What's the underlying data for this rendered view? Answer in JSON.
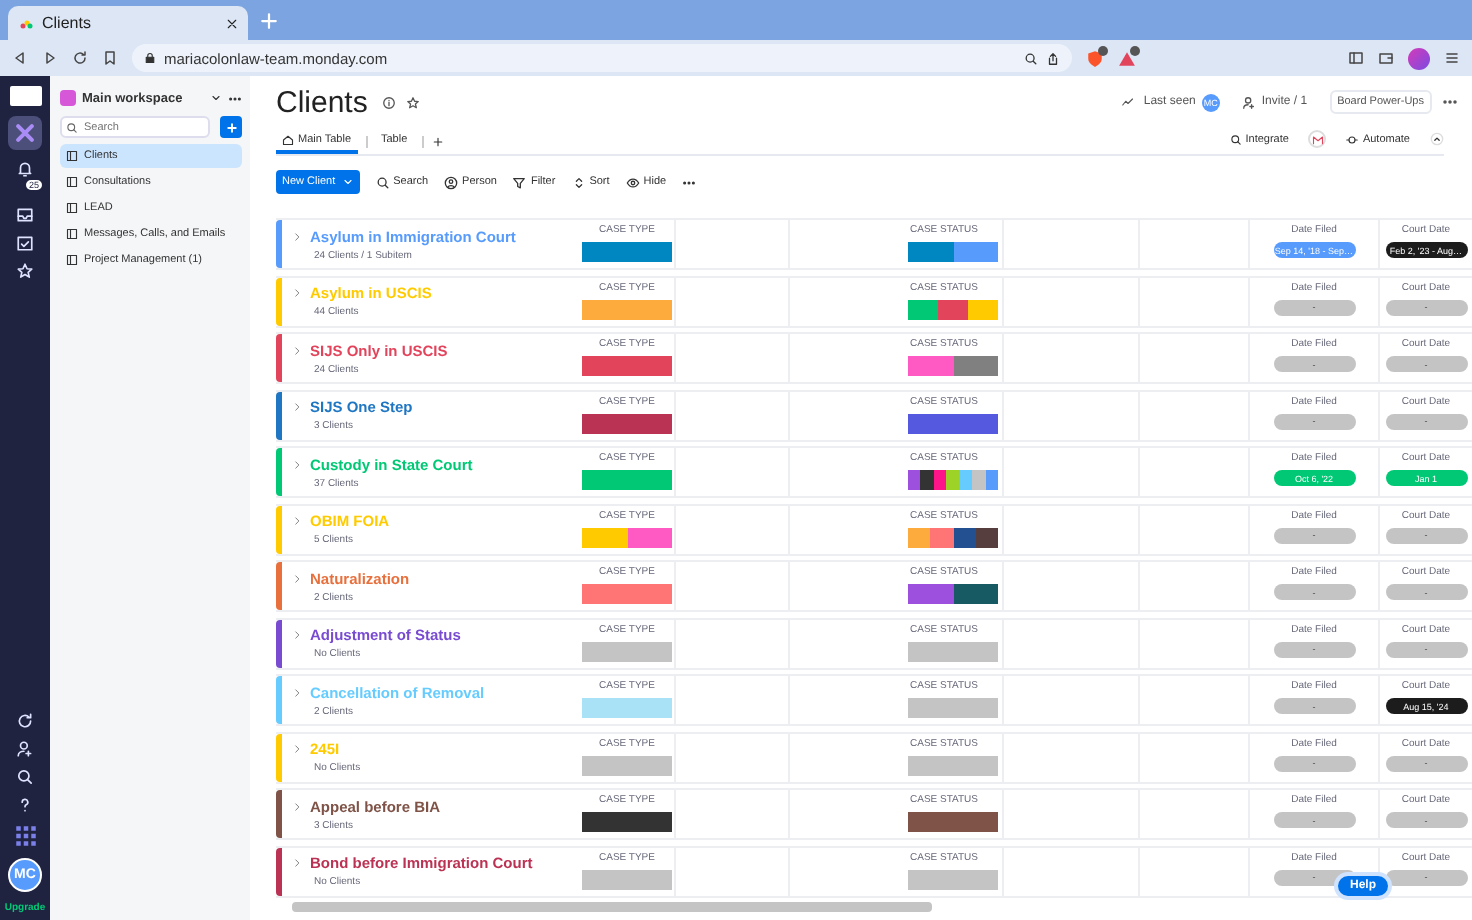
{
  "browser": {
    "tab_title": "Clients",
    "url": "mariacolonlaw-team.monday.com"
  },
  "rail": {
    "badge": "25",
    "avatar": "MC",
    "upgrade": "Upgrade"
  },
  "workspace": {
    "name": "Main workspace",
    "search_placeholder": "Search",
    "items": [
      {
        "label": "Clients",
        "selected": true
      },
      {
        "label": "Consultations",
        "selected": false
      },
      {
        "label": "LEAD",
        "selected": false
      },
      {
        "label": "Messages, Calls, and Emails",
        "selected": false
      },
      {
        "label": "Project Management (1)",
        "selected": false
      }
    ]
  },
  "board": {
    "title": "Clients",
    "last_seen": "Last seen",
    "last_seen_avatar": "MC",
    "invite": "Invite / 1",
    "power_ups": "Board Power-Ups",
    "integrate": "Integrate",
    "automate": "Automate",
    "views": [
      {
        "label": "Main Table",
        "selected": true
      },
      {
        "label": "Table",
        "selected": false
      }
    ],
    "new_button": "New Client",
    "actions": [
      {
        "label": "Search",
        "kind": "search"
      },
      {
        "label": "Person",
        "kind": "person"
      },
      {
        "label": "Filter",
        "kind": "filter"
      },
      {
        "label": "Sort",
        "kind": "sort"
      },
      {
        "label": "Hide",
        "kind": "hide"
      }
    ]
  },
  "groups": [
    {
      "name": "Asylum in Immigration Court",
      "count": "24 Clients / 1 Subitem",
      "color": "#579bfc",
      "case_type": {
        "label": "CASE TYPE",
        "segments": [
          {
            "color": "#0086c0"
          }
        ]
      },
      "case_status": {
        "label": "CASE STATUS",
        "segments": [
          {
            "color": "#0086c0"
          },
          {
            "color": "#579bfc"
          }
        ]
      },
      "date_filed": {
        "label": "Date Filed",
        "value": "Sep 14, '18 - Sep…",
        "color": "#579bfc"
      },
      "court_date": {
        "label": "Court Date",
        "value": "Feb 2, '23 - Aug…",
        "color": "#1c1c1c"
      }
    },
    {
      "name": "Asylum in USCIS",
      "count": "44 Clients",
      "color": "#ffcb00",
      "case_type": {
        "label": "CASE TYPE",
        "segments": [
          {
            "color": "#fdab3d"
          }
        ]
      },
      "case_status": {
        "label": "CASE STATUS",
        "segments": [
          {
            "color": "#00c875"
          },
          {
            "color": "#e2445c"
          },
          {
            "color": "#ffcb00"
          }
        ]
      },
      "date_filed": {
        "label": "Date Filed",
        "value": "-",
        "color": "#c4c4c4"
      },
      "court_date": {
        "label": "Court Date",
        "value": "-",
        "color": "#c4c4c4"
      }
    },
    {
      "name": "SIJS Only in USCIS",
      "count": "24 Clients",
      "color": "#e2445c",
      "case_type": {
        "label": "CASE TYPE",
        "segments": [
          {
            "color": "#e2445c"
          }
        ]
      },
      "case_status": {
        "label": "CASE STATUS",
        "segments": [
          {
            "color": "#ff5ac4"
          },
          {
            "color": "#808080"
          }
        ]
      },
      "date_filed": {
        "label": "Date Filed",
        "value": "-",
        "color": "#c4c4c4"
      },
      "court_date": {
        "label": "Court Date",
        "value": "-",
        "color": "#c4c4c4"
      }
    },
    {
      "name": "SIJS One Step",
      "count": "3 Clients",
      "color": "#1f76c2",
      "case_type": {
        "label": "CASE TYPE",
        "segments": [
          {
            "color": "#bb3354"
          }
        ]
      },
      "case_status": {
        "label": "CASE STATUS",
        "segments": [
          {
            "color": "#5559df"
          }
        ]
      },
      "date_filed": {
        "label": "Date Filed",
        "value": "-",
        "color": "#c4c4c4"
      },
      "court_date": {
        "label": "Court Date",
        "value": "-",
        "color": "#c4c4c4"
      }
    },
    {
      "name": "Custody in State Court",
      "count": "37 Clients",
      "color": "#00c875",
      "case_type": {
        "label": "CASE TYPE",
        "segments": [
          {
            "color": "#00c875"
          }
        ]
      },
      "case_status": {
        "label": "CASE STATUS",
        "segments": [
          {
            "color": "#9d50dd"
          },
          {
            "color": "#333333"
          },
          {
            "color": "#ff158a"
          },
          {
            "color": "#9cd326"
          },
          {
            "color": "#66ccff"
          },
          {
            "color": "#c4c4c4"
          },
          {
            "color": "#579bfc"
          }
        ]
      },
      "date_filed": {
        "label": "Date Filed",
        "value": "Oct 6, '22",
        "color": "#00c875"
      },
      "court_date": {
        "label": "Court Date",
        "value": "Jan 1",
        "color": "#00c875"
      }
    },
    {
      "name": "OBIM FOIA",
      "count": "5 Clients",
      "color": "#ffcb00",
      "case_type": {
        "label": "CASE TYPE",
        "segments": [
          {
            "color": "#ffcb00"
          },
          {
            "color": "#ff5ac4"
          }
        ]
      },
      "case_status": {
        "label": "CASE STATUS",
        "segments": [
          {
            "color": "#fdab3d"
          },
          {
            "color": "#ff7575"
          },
          {
            "color": "#225091"
          },
          {
            "color": "#563e3e"
          }
        ]
      },
      "date_filed": {
        "label": "Date Filed",
        "value": "-",
        "color": "#c4c4c4"
      },
      "court_date": {
        "label": "Court Date",
        "value": "-",
        "color": "#c4c4c4"
      }
    },
    {
      "name": "Naturalization",
      "count": "2 Clients",
      "color": "#e8703d",
      "case_type": {
        "label": "CASE TYPE",
        "segments": [
          {
            "color": "#ff7575"
          }
        ]
      },
      "case_status": {
        "label": "CASE STATUS",
        "segments": [
          {
            "color": "#9d50dd"
          },
          {
            "color": "#175a63"
          }
        ]
      },
      "date_filed": {
        "label": "Date Filed",
        "value": "-",
        "color": "#c4c4c4"
      },
      "court_date": {
        "label": "Court Date",
        "value": "-",
        "color": "#c4c4c4"
      }
    },
    {
      "name": "Adjustment of Status",
      "count": "No Clients",
      "color": "#784bd1",
      "case_type": {
        "label": "CASE TYPE",
        "segments": [
          {
            "color": "#c4c4c4"
          }
        ]
      },
      "case_status": {
        "label": "CASE STATUS",
        "segments": [
          {
            "color": "#c4c4c4"
          }
        ]
      },
      "date_filed": {
        "label": "Date Filed",
        "value": "-",
        "color": "#c4c4c4"
      },
      "court_date": {
        "label": "Court Date",
        "value": "-",
        "color": "#c4c4c4"
      }
    },
    {
      "name": "Cancellation of Removal",
      "count": "2 Clients",
      "color": "#66ccff",
      "case_type": {
        "label": "CASE TYPE",
        "segments": [
          {
            "color": "#a9e2f7"
          }
        ]
      },
      "case_status": {
        "label": "CASE STATUS",
        "segments": [
          {
            "color": "#c4c4c4"
          }
        ]
      },
      "date_filed": {
        "label": "Date Filed",
        "value": "-",
        "color": "#c4c4c4"
      },
      "court_date": {
        "label": "Court Date",
        "value": "Aug 15, '24",
        "color": "#1c1c1c"
      }
    },
    {
      "name": "245I",
      "count": "No Clients",
      "color": "#ffcb00",
      "case_type": {
        "label": "CASE TYPE",
        "segments": [
          {
            "color": "#c4c4c4"
          }
        ]
      },
      "case_status": {
        "label": "CASE STATUS",
        "segments": [
          {
            "color": "#c4c4c4"
          }
        ]
      },
      "date_filed": {
        "label": "Date Filed",
        "value": "-",
        "color": "#c4c4c4"
      },
      "court_date": {
        "label": "Court Date",
        "value": "-",
        "color": "#c4c4c4"
      }
    },
    {
      "name": "Appeal before BIA",
      "count": "3 Clients",
      "color": "#7f5347",
      "case_type": {
        "label": "CASE TYPE",
        "segments": [
          {
            "color": "#333333"
          }
        ]
      },
      "case_status": {
        "label": "CASE STATUS",
        "segments": [
          {
            "color": "#7f5347"
          }
        ]
      },
      "date_filed": {
        "label": "Date Filed",
        "value": "-",
        "color": "#c4c4c4"
      },
      "court_date": {
        "label": "Court Date",
        "value": "-",
        "color": "#c4c4c4"
      }
    },
    {
      "name": "Bond before Immigration Court",
      "count": "No Clients",
      "color": "#bb3354",
      "case_type": {
        "label": "CASE TYPE",
        "segments": [
          {
            "color": "#c4c4c4"
          }
        ]
      },
      "case_status": {
        "label": "CASE STATUS",
        "segments": [
          {
            "color": "#c4c4c4"
          }
        ]
      },
      "date_filed": {
        "label": "Date Filed",
        "value": "-",
        "color": "#c4c4c4"
      },
      "court_date": {
        "label": "Court Date",
        "value": "-",
        "color": "#c4c4c4"
      }
    }
  ],
  "help": "Help"
}
